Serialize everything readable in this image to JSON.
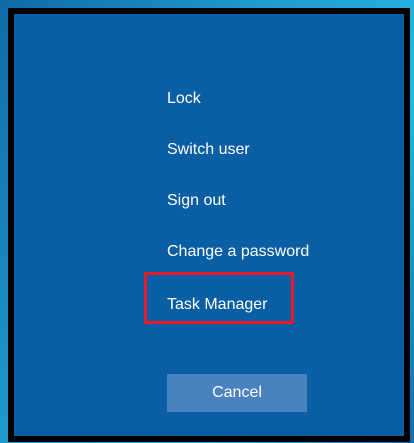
{
  "menu": {
    "items": [
      {
        "label": "Lock"
      },
      {
        "label": "Switch user"
      },
      {
        "label": "Sign out"
      },
      {
        "label": "Change a password"
      },
      {
        "label": "Task Manager"
      }
    ]
  },
  "cancel": {
    "label": "Cancel"
  },
  "colors": {
    "panel_background": "#0a5ea3",
    "frame_border": "#000000",
    "text": "#ffffff",
    "cancel_button": "#4a82bf",
    "highlight": "#e8192c"
  }
}
